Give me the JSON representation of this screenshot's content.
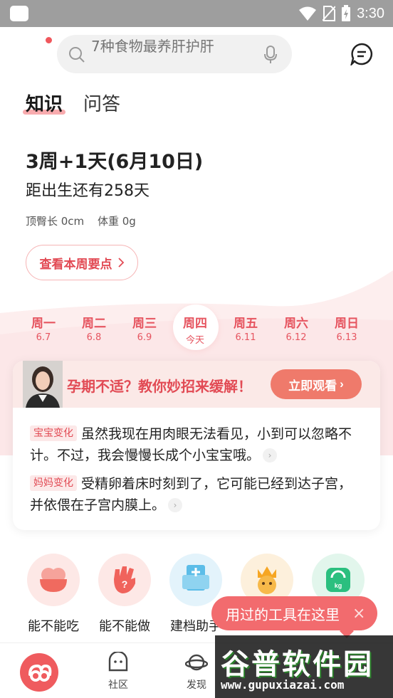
{
  "status_bar": {
    "time": "3:30"
  },
  "header": {
    "search_placeholder": "7种食物最养肝护肝"
  },
  "tabs": [
    {
      "label": "知识"
    },
    {
      "label": "问答"
    }
  ],
  "week": {
    "title": "3周+1天(6月10日)",
    "subtitle": "距出生还有258天",
    "crl": "顶臀长 0cm",
    "weight": "体重 0g",
    "button_label": "查看本周要点"
  },
  "days": [
    {
      "name": "周一",
      "date": "6.7"
    },
    {
      "name": "周二",
      "date": "6.8"
    },
    {
      "name": "周三",
      "date": "6.9"
    },
    {
      "name": "周四",
      "date": "今天"
    },
    {
      "name": "周五",
      "date": "6.11"
    },
    {
      "name": "周六",
      "date": "6.12"
    },
    {
      "name": "周日",
      "date": "6.13"
    }
  ],
  "banner": {
    "text": "孕期不适？教你妙招来缓解！",
    "button_label": "立即观看"
  },
  "baby_change": {
    "tag": "宝宝变化",
    "text": "虽然我现在用肉眼无法看见，小到可以忽略不计。不过，我会慢慢长成个小宝宝哦。"
  },
  "mom_change": {
    "tag": "妈妈变化",
    "text": "受精卵着床时刻到了，它可能已经到达子宫，并依偎在子宫内膜上。"
  },
  "tools": [
    {
      "label": "能不能吃",
      "color": "#fde8e6"
    },
    {
      "label": "能不能做",
      "color": "#fde8e6"
    },
    {
      "label": "建档助手",
      "color": "#e3f3fb"
    },
    {
      "label": "",
      "color": "#fdf0dc"
    },
    {
      "label": "",
      "color": "#e2f6ec"
    }
  ],
  "tooltip": {
    "text": "用过的工具在这里",
    "close": "×"
  },
  "bottom_nav": [
    {
      "label": "社区"
    },
    {
      "label": "发现"
    }
  ],
  "watermark": {
    "title": "谷普软件园",
    "url": "www.gupuxiazai.com"
  },
  "colors": {
    "accent": "#e24b55",
    "button": "#ef7a6b",
    "tooltip": "#f26b6e"
  }
}
